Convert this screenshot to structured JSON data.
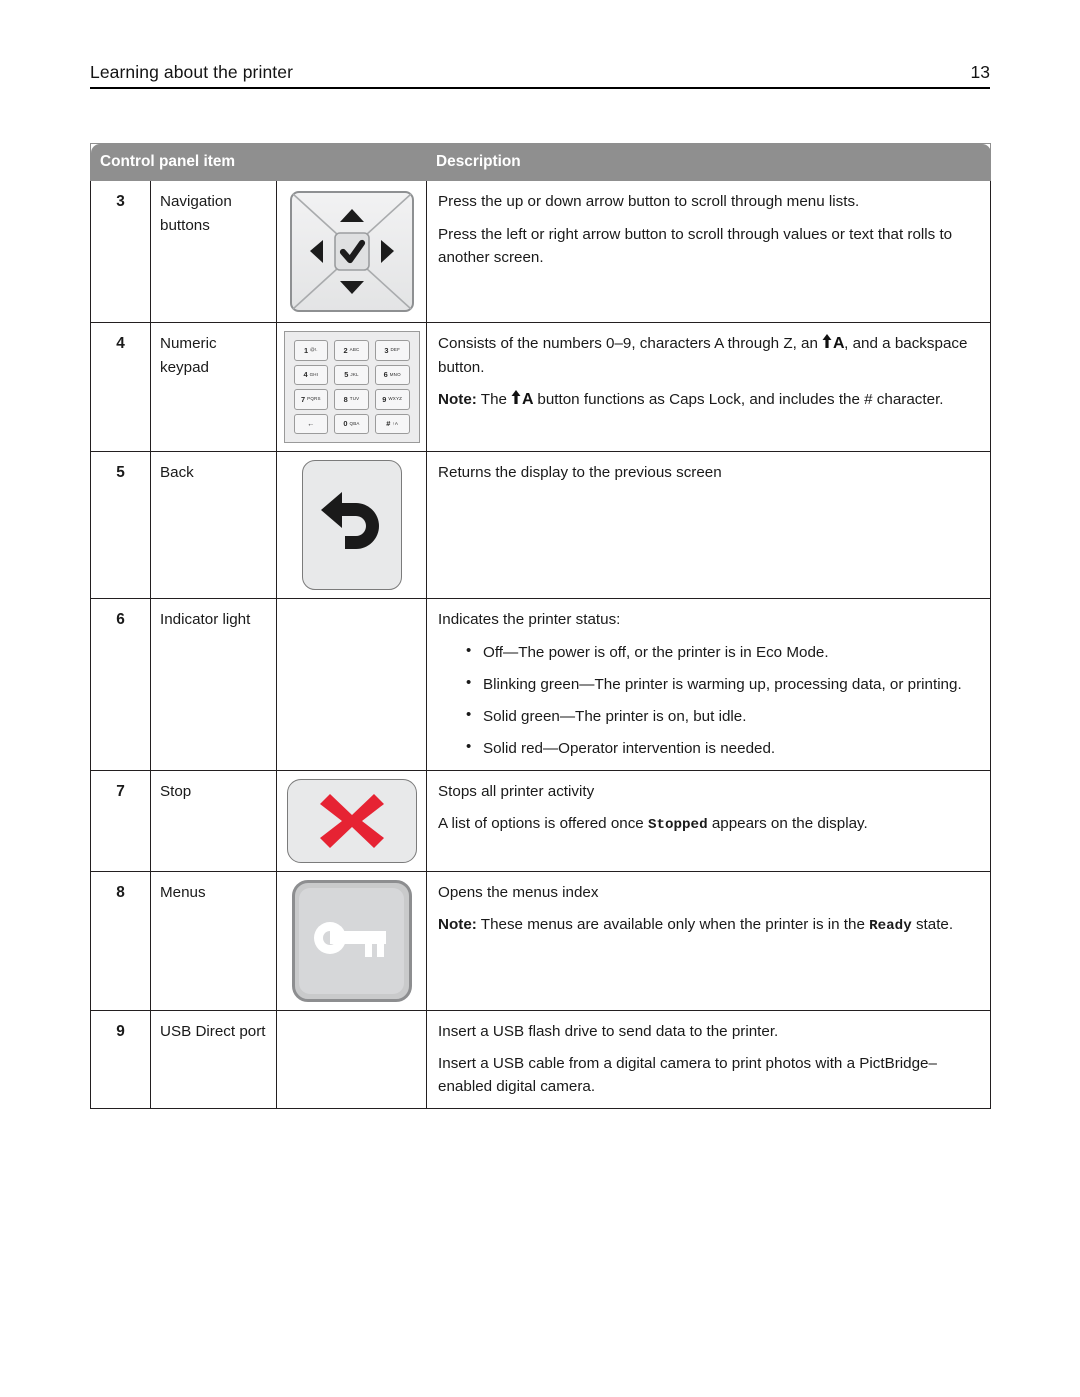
{
  "page": {
    "header_title": "Learning about the printer",
    "page_number": "13"
  },
  "table": {
    "columns": [
      "Control panel item",
      "Description"
    ],
    "header_bg": "#8f8f8f",
    "header_text_color": "#ffffff",
    "border_color": "#231f20",
    "rows": [
      {
        "number": "3",
        "name": "Navigation buttons",
        "icon": "navigation-pad-icon",
        "description_paragraphs": [
          "Press the up or down arrow button to scroll through menu lists.",
          "Press the left or right arrow button to scroll through values or text that rolls to another screen."
        ]
      },
      {
        "number": "4",
        "name": "Numeric keypad",
        "icon": "numeric-keypad-icon",
        "keypad_keys": [
          {
            "digit": "1",
            "letters": "@!."
          },
          {
            "digit": "2",
            "letters": "ABC"
          },
          {
            "digit": "3",
            "letters": "DEF"
          },
          {
            "digit": "4",
            "letters": "GHI"
          },
          {
            "digit": "5",
            "letters": "JKL"
          },
          {
            "digit": "6",
            "letters": "MNO"
          },
          {
            "digit": "7",
            "letters": "PQRS"
          },
          {
            "digit": "8",
            "letters": "TUV"
          },
          {
            "digit": "9",
            "letters": "WXYZ"
          },
          {
            "digit": "←",
            "letters": ""
          },
          {
            "digit": "0",
            "letters": "QBA"
          },
          {
            "digit": "#",
            "letters": "↑A"
          }
        ],
        "description_segments": [
          {
            "type": "text",
            "value": "Consists of the numbers 0–9, characters A through Z, an "
          },
          {
            "type": "shift-a-icon",
            "value": "↑A"
          },
          {
            "type": "text",
            "value": ", and a backspace button."
          }
        ],
        "note_segments": [
          {
            "type": "bold",
            "value": "Note:"
          },
          {
            "type": "text",
            "value": " The "
          },
          {
            "type": "shift-a-icon",
            "value": "↑A"
          },
          {
            "type": "text",
            "value": " button functions as Caps Lock, and includes the # character."
          }
        ]
      },
      {
        "number": "5",
        "name": "Back",
        "icon": "back-arrow-icon",
        "description_paragraphs": [
          "Returns the display to the previous screen"
        ]
      },
      {
        "number": "6",
        "name": "Indicator light",
        "icon": "",
        "description_intro": "Indicates the printer status:",
        "bullets": [
          "Off—The power is off, or the printer is in Eco Mode.",
          "Blinking green—The printer is warming up, processing data, or printing.",
          "Solid green—The printer is on, but idle.",
          "Solid red—Operator intervention is needed."
        ]
      },
      {
        "number": "7",
        "name": "Stop",
        "icon": "stop-x-icon",
        "icon_color": "#e62333",
        "description_paragraphs": [
          "Stops all printer activity"
        ],
        "mono_sentence": {
          "before": "A list of options is offered once ",
          "mono": "Stopped",
          "after": " appears on the display."
        }
      },
      {
        "number": "8",
        "name": "Menus",
        "icon": "key-icon",
        "description_paragraphs": [
          "Opens the menus index"
        ],
        "note_sentence": {
          "bold_label": "Note:",
          "before": " These menus are available only when the printer is in the ",
          "mono": "Ready",
          "after": " state."
        }
      },
      {
        "number": "9",
        "name": "USB Direct port",
        "icon": "",
        "description_paragraphs": [
          "Insert a USB flash drive to send data to the printer.",
          "Insert a USB cable from a digital camera to print photos with a PictBridge–enabled digital camera."
        ]
      }
    ]
  }
}
